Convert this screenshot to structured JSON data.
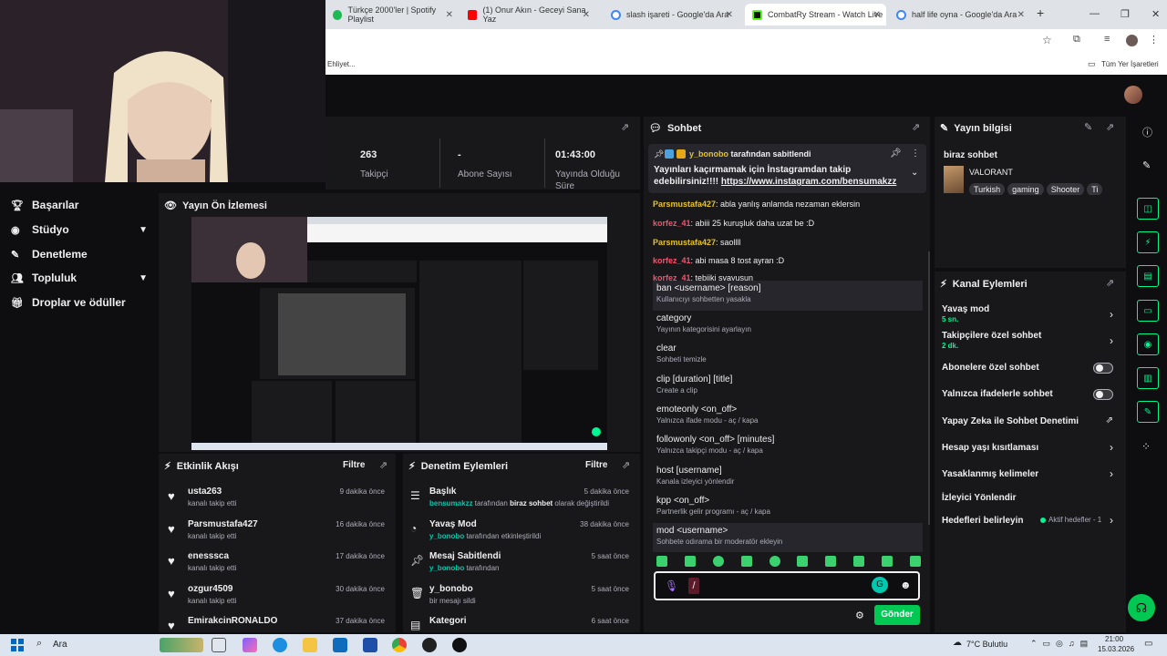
{
  "browser": {
    "tabs": [
      {
        "label": "Türkçe 2000'ler | Spotify Playlist",
        "color": "#1db954"
      },
      {
        "label": "(1) Onur Akın - Geceyi Sana Yaz",
        "color": "#ff0000"
      },
      {
        "label": "slash işareti - Google'da Ara",
        "color": "#4285f4"
      },
      {
        "label": "CombatRy Stream - Watch Live",
        "color": "#53fc18"
      },
      {
        "label": "half life oyna - Google'da Ara",
        "color": "#4285f4"
      }
    ],
    "bookmark_left": "Ehliyet...",
    "bookmark_right": "Tüm Yer İşaretleri"
  },
  "sidebar": {
    "items": [
      {
        "label": "Başarılar",
        "icon": "trophy-icon"
      },
      {
        "label": "Stüdyo",
        "icon": "studio-icon"
      },
      {
        "label": "Denetleme",
        "icon": "wrench-icon"
      },
      {
        "label": "Topluluk",
        "icon": "people-icon"
      },
      {
        "label": "Droplar ve ödüller",
        "icon": "gift-icon"
      }
    ]
  },
  "stats": [
    {
      "value": "263",
      "label": "Takipçi"
    },
    {
      "value": "-",
      "label": "Abone Sayısı"
    },
    {
      "value": "01:43:00",
      "label": "Yayında Olduğu Süre"
    }
  ],
  "preview": {
    "title": "Yayın Ön İzlemesi"
  },
  "activity": {
    "title": "Etkinlik Akışı",
    "filter": "Filtre",
    "items": [
      {
        "name": "usta263",
        "sub": "kanalı takip etti",
        "time": "9 dakika önce"
      },
      {
        "name": "Parsmustafa427",
        "sub": "kanalı takip etti",
        "time": "16 dakika önce"
      },
      {
        "name": "enesssca",
        "sub": "kanalı takip etti",
        "time": "17 dakika önce"
      },
      {
        "name": "ozgur4509",
        "sub": "kanalı takip etti",
        "time": "30 dakika önce"
      },
      {
        "name": "EmirakcinRONALDO",
        "sub": "",
        "time": "37 dakika önce"
      }
    ]
  },
  "modactions": {
    "title": "Denetim Eylemleri",
    "filter": "Filtre",
    "items": [
      {
        "name": "Başlık",
        "user": "bensumakzz",
        "mid": " tarafından ",
        "bold": "biraz sohbet",
        "end": " olarak değiştirildi",
        "time": "5 dakika önce"
      },
      {
        "name": "Yavaş Mod",
        "user": "y_bonobo",
        "mid": " tarafından etkinleştirildi",
        "bold": "",
        "end": "",
        "time": "38 dakika önce"
      },
      {
        "name": "Mesaj Sabitlendi",
        "user": "y_bonobo",
        "mid": " tarafından",
        "bold": "",
        "end": "",
        "time": "5 saat önce"
      },
      {
        "name": "y_bonobo",
        "user": "",
        "mid": "bir mesajı sildi",
        "bold": "",
        "end": "",
        "time": "5 saat önce"
      },
      {
        "name": "Kategori",
        "user": "",
        "mid": "",
        "bold": "",
        "end": "",
        "time": "6 saat önce"
      }
    ]
  },
  "chat": {
    "title": "Sohbet",
    "pinned_by": "y_bonobo",
    "pinned_suffix": " tarafından sabitlendi",
    "pinned_text": "Yayınları kaçırmamak için İnstagramdan takip edebilirsiniz!!!! ",
    "pinned_link": "https://www.instagram.com/bensumakzz",
    "messages": [
      {
        "user": "Parsmustafa427",
        "color": "#e6c229",
        "text": ": abla yanlış anlamda nezaman eklersin"
      },
      {
        "user": "korfez_41",
        "color": "#ff4d6d",
        "text": ": abiii 25 kuruşluk daha uzat be :D"
      },
      {
        "user": "Parsmustafa427",
        "color": "#e6c229",
        "text": ": saollll"
      },
      {
        "user": "korfez_41",
        "color": "#ff4d6d",
        "text": ": abi masa 8 tost ayran :D"
      },
      {
        "user": "korfez_41",
        "color": "#ff4d6d",
        "text": ": tebiiki svayusun"
      }
    ],
    "commands": [
      {
        "cmd": "ban <username> [reason]",
        "desc": "Kullanıcıyı sohbetten yasakla"
      },
      {
        "cmd": "category",
        "desc": "Yayının kategorisini ayarlayın"
      },
      {
        "cmd": "clear",
        "desc": "Sohbeti temizle"
      },
      {
        "cmd": "clip [duration] [title]",
        "desc": "Create a clip"
      },
      {
        "cmd": "emoteonly <on_off>",
        "desc": "Yalnızca ifade modu - aç / kapa"
      },
      {
        "cmd": "followonly <on_off> [minutes]",
        "desc": "Yalnızca takipçi modu - aç / kapa"
      },
      {
        "cmd": "host [username]",
        "desc": "Kanala izleyici yönlendir"
      },
      {
        "cmd": "kpp <on_off>",
        "desc": "Partnerlik gelir programı - aç / kapa"
      },
      {
        "cmd": "mod <username>",
        "desc": "Sohbete odırama bir moderatör ekleyin"
      }
    ],
    "input_value": "/",
    "send_label": "Gönder"
  },
  "stream_info": {
    "title": "Yayın bilgisi",
    "stream_title": "biraz sohbet",
    "category": "VALORANT",
    "tags": [
      "Turkish",
      "gaming",
      "Shooter",
      "Ti"
    ]
  },
  "channel_actions": {
    "title": "Kanal Eylemleri",
    "items": [
      {
        "label": "Yavaş mod",
        "sub": "5 sn."
      },
      {
        "label": "Takipçilere özel sohbet",
        "sub": "2 dk."
      },
      {
        "label": "Abonelere özel sohbet",
        "sub": ""
      },
      {
        "label": "Yalnızca ifadelerle sohbet",
        "sub": ""
      },
      {
        "label": "Yapay Zeka ile Sohbet Denetimi",
        "sub": ""
      },
      {
        "label": "Hesap yaşı kısıtlaması",
        "sub": ""
      },
      {
        "label": "Yasaklanmış kelimeler",
        "sub": ""
      },
      {
        "label": "İzleyici Yönlendir",
        "sub": ""
      },
      {
        "label": "Hedefleri belirleyin",
        "sub": ""
      }
    ],
    "goals_status": "Aktif hedefler - 1"
  },
  "taskbar": {
    "search": "Ara",
    "weather": "7°C  Bulutlu",
    "time": "21:00",
    "date": "15.03.2026"
  },
  "colors": {
    "accent": "#00f593",
    "panel": "#18181b",
    "bg": "#0e0e10"
  }
}
